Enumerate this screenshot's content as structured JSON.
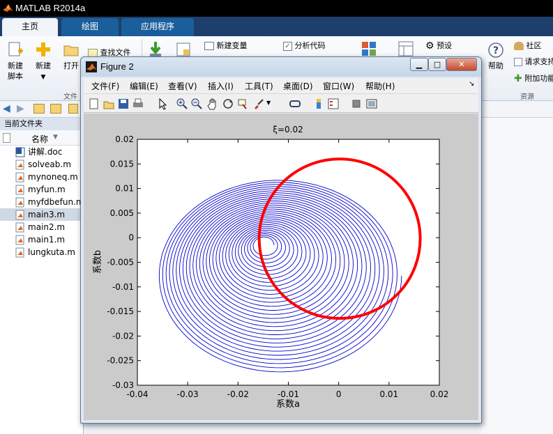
{
  "app": {
    "title": "MATLAB R2014a"
  },
  "tabs": [
    {
      "label": "主页",
      "active": true
    },
    {
      "label": "绘图",
      "active": false
    },
    {
      "label": "应用程序",
      "active": false
    }
  ],
  "ribbon": {
    "new_script": [
      "新建",
      "脚本"
    ],
    "new": "新建",
    "open": "打开",
    "find_files": "查找文件",
    "new_variable": "新建变量",
    "analyze_code": "分析代码",
    "preferences": "预设",
    "help": "帮助",
    "community": "社区",
    "request_support": "请求支持",
    "add_ons": "附加功能",
    "group_file": "文件",
    "group_resources": "资源"
  },
  "current_folder": {
    "title": "当前文件夹",
    "column_name": "名称",
    "files": [
      {
        "name": "讲解.doc",
        "type": "doc",
        "selected": false
      },
      {
        "name": "solveab.m",
        "type": "m",
        "selected": false
      },
      {
        "name": "mynoneq.m",
        "type": "m",
        "selected": false
      },
      {
        "name": "myfun.m",
        "type": "m",
        "selected": false
      },
      {
        "name": "myfdbefun.m",
        "type": "m",
        "selected": false
      },
      {
        "name": "main3.m",
        "type": "m",
        "selected": true
      },
      {
        "name": "main2.m",
        "type": "m",
        "selected": false
      },
      {
        "name": "main1.m",
        "type": "m",
        "selected": false
      },
      {
        "name": "lungkuta.m",
        "type": "m",
        "selected": false
      }
    ]
  },
  "figure": {
    "title": "Figure 2",
    "menu": [
      "文件(F)",
      "编辑(E)",
      "查看(V)",
      "插入(I)",
      "工具(T)",
      "桌面(D)",
      "窗口(W)",
      "帮助(H)"
    ],
    "toolbar_icons": [
      "new-figure-icon",
      "open-icon",
      "save-icon",
      "print-icon",
      "pointer-icon",
      "zoom-in-icon",
      "zoom-out-icon",
      "pan-icon",
      "rotate-icon",
      "data-cursor-icon",
      "brush-icon",
      "link-icon",
      "colorbar-icon",
      "legend-icon",
      "hide-plot-tools-icon",
      "show-plot-tools-icon"
    ]
  },
  "chart_data": {
    "type": "line",
    "title": "ξ=0.02",
    "xlabel": "系数a",
    "ylabel": "系数b",
    "xlim": [
      -0.04,
      0.02
    ],
    "ylim": [
      -0.03,
      0.02
    ],
    "xticks": [
      "-0.04",
      "-0.03",
      "-0.02",
      "-0.01",
      "0",
      "0.01",
      "0.02"
    ],
    "yticks": [
      "0.02",
      "0.015",
      "0.01",
      "0.005",
      "0",
      "-0.005",
      "-0.01",
      "-0.015",
      "-0.02",
      "-0.025",
      "-0.03"
    ],
    "series": [
      {
        "color": "#0000cc",
        "description_points": {
          "spiral_center": [
            -0.0148,
            -0.0015
          ],
          "outer_x_extent": [
            -0.036,
            0.0125
          ],
          "outer_y_extent": [
            -0.0275,
            0.012
          ]
        }
      }
    ],
    "annotation": {
      "shape": "circle",
      "color": "#ff0000",
      "center": [
        0.0002,
        -0.0002
      ],
      "radius_x": 0.016,
      "radius_y": 0.0162
    },
    "grid": false,
    "colors": {
      "line": "#0000cc",
      "annotation": "#ff0000"
    }
  }
}
